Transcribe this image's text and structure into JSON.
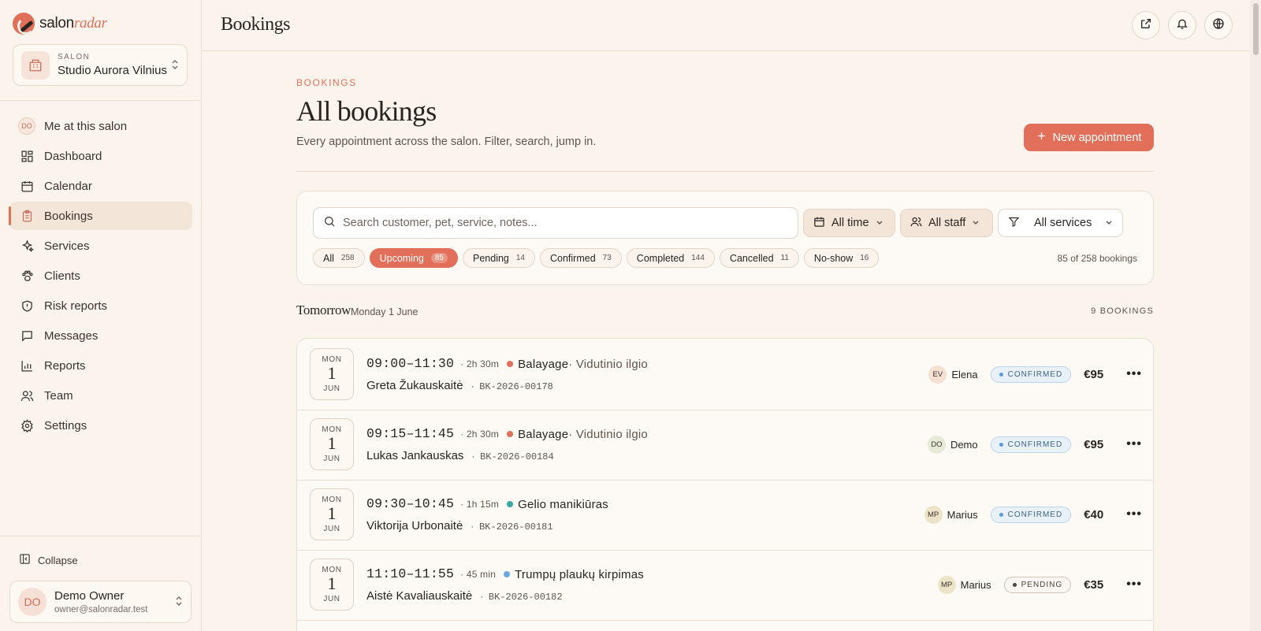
{
  "brand": {
    "name_a": "salon",
    "name_b": "radar"
  },
  "salon": {
    "label": "SALON",
    "name": "Studio Aurora Vilnius"
  },
  "nav": {
    "me": {
      "initials": "DO",
      "label": "Me at this salon"
    },
    "items": [
      {
        "label": "Dashboard",
        "icon": "dashboard-icon"
      },
      {
        "label": "Calendar",
        "icon": "calendar-icon"
      },
      {
        "label": "Bookings",
        "icon": "clipboard-icon",
        "active": true
      },
      {
        "label": "Services",
        "icon": "sparkles-icon"
      },
      {
        "label": "Clients",
        "icon": "paw-icon"
      },
      {
        "label": "Risk reports",
        "icon": "shield-icon"
      },
      {
        "label": "Messages",
        "icon": "chat-icon"
      },
      {
        "label": "Reports",
        "icon": "bar-chart-icon"
      },
      {
        "label": "Team",
        "icon": "users-icon"
      },
      {
        "label": "Settings",
        "icon": "gear-icon"
      }
    ],
    "collapse_label": "Collapse"
  },
  "user": {
    "initials": "DO",
    "name": "Demo Owner",
    "email": "owner@salonradar.test"
  },
  "header": {
    "title": "Bookings"
  },
  "page": {
    "eyebrow": "BOOKINGS",
    "title": "All bookings",
    "subtitle": "Every appointment across the salon. Filter, search, jump in.",
    "new_button": "New appointment"
  },
  "filters": {
    "search_placeholder": "Search customer, pet, service, notes...",
    "time": "All time",
    "staff": "All staff",
    "services": "All services",
    "chips": [
      {
        "label": "All",
        "count": "258"
      },
      {
        "label": "Upcoming",
        "count": "85",
        "active": true
      },
      {
        "label": "Pending",
        "count": "14"
      },
      {
        "label": "Confirmed",
        "count": "73"
      },
      {
        "label": "Completed",
        "count": "144"
      },
      {
        "label": "Cancelled",
        "count": "11"
      },
      {
        "label": "No-show",
        "count": "16"
      }
    ],
    "result_count": "85 of 258 bookings"
  },
  "day": {
    "title": "Tomorrow",
    "subtitle": "Monday 1 June",
    "count": "9 BOOKINGS"
  },
  "bookings": [
    {
      "dow": "MON",
      "day": "1",
      "mon": "JUN",
      "time": "09:00–11:30",
      "duration": "2h 30m",
      "service": "Balayage",
      "variant": "· Vidutinio ilgio",
      "dot_color": "#e0705a",
      "client": "Greta Žukauskaitė",
      "ref": "BK-2026-00178",
      "staff_initials": "EV",
      "staff_name": "Elena",
      "staff_color": "#f6e0d2",
      "status": "CONFIRMED",
      "status_type": "confirmed",
      "price": "€95"
    },
    {
      "dow": "MON",
      "day": "1",
      "mon": "JUN",
      "time": "09:15–11:45",
      "duration": "2h 30m",
      "service": "Balayage",
      "variant": "· Vidutinio ilgio",
      "dot_color": "#e0705a",
      "client": "Lukas Jankauskas",
      "ref": "BK-2026-00184",
      "staff_initials": "DO",
      "staff_name": "Demo",
      "staff_color": "#e6ead6",
      "status": "CONFIRMED",
      "status_type": "confirmed",
      "price": "€95"
    },
    {
      "dow": "MON",
      "day": "1",
      "mon": "JUN",
      "time": "09:30–10:45",
      "duration": "1h 15m",
      "service": "Gelio manikiūras",
      "variant": "",
      "dot_color": "#3aa7a3",
      "client": "Viktorija Urbonaitė",
      "ref": "BK-2026-00181",
      "staff_initials": "MP",
      "staff_name": "Marius",
      "staff_color": "#ede3c6",
      "status": "CONFIRMED",
      "status_type": "confirmed",
      "price": "€40"
    },
    {
      "dow": "MON",
      "day": "1",
      "mon": "JUN",
      "time": "11:10–11:55",
      "duration": "45 min",
      "service": "Trumpų plaukų kirpimas",
      "variant": "",
      "dot_color": "#6aa8e0",
      "client": "Aistė Kavaliauskaitė",
      "ref": "BK-2026-00182",
      "staff_initials": "MP",
      "staff_name": "Marius",
      "staff_color": "#ede3c6",
      "status": "PENDING",
      "status_type": "pending",
      "price": "€35"
    }
  ]
}
